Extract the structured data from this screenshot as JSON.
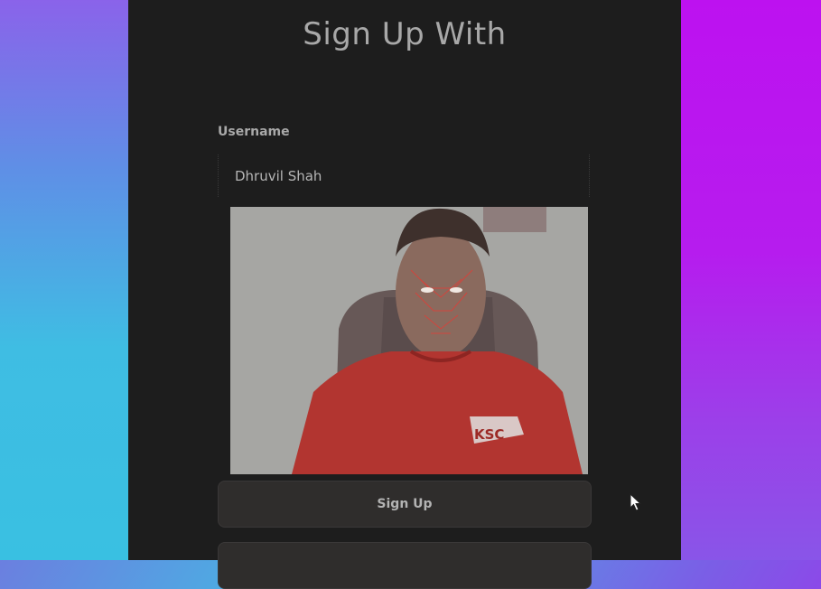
{
  "page": {
    "title": "Sign Up With"
  },
  "form": {
    "username_label": "Username",
    "username_value": "Dhruvil Shah"
  },
  "camera": {
    "shirt_logo": "KSC"
  },
  "buttons": {
    "signup_label": "Sign Up",
    "second_label": ""
  },
  "colors": {
    "panel_bg": "#1d1d1d",
    "gradient_left": "#39c0e2",
    "gradient_right": "#b515ee",
    "button_bg": "#2f2d2c"
  },
  "icons": {
    "cursor": "mouse-pointer-icon"
  }
}
